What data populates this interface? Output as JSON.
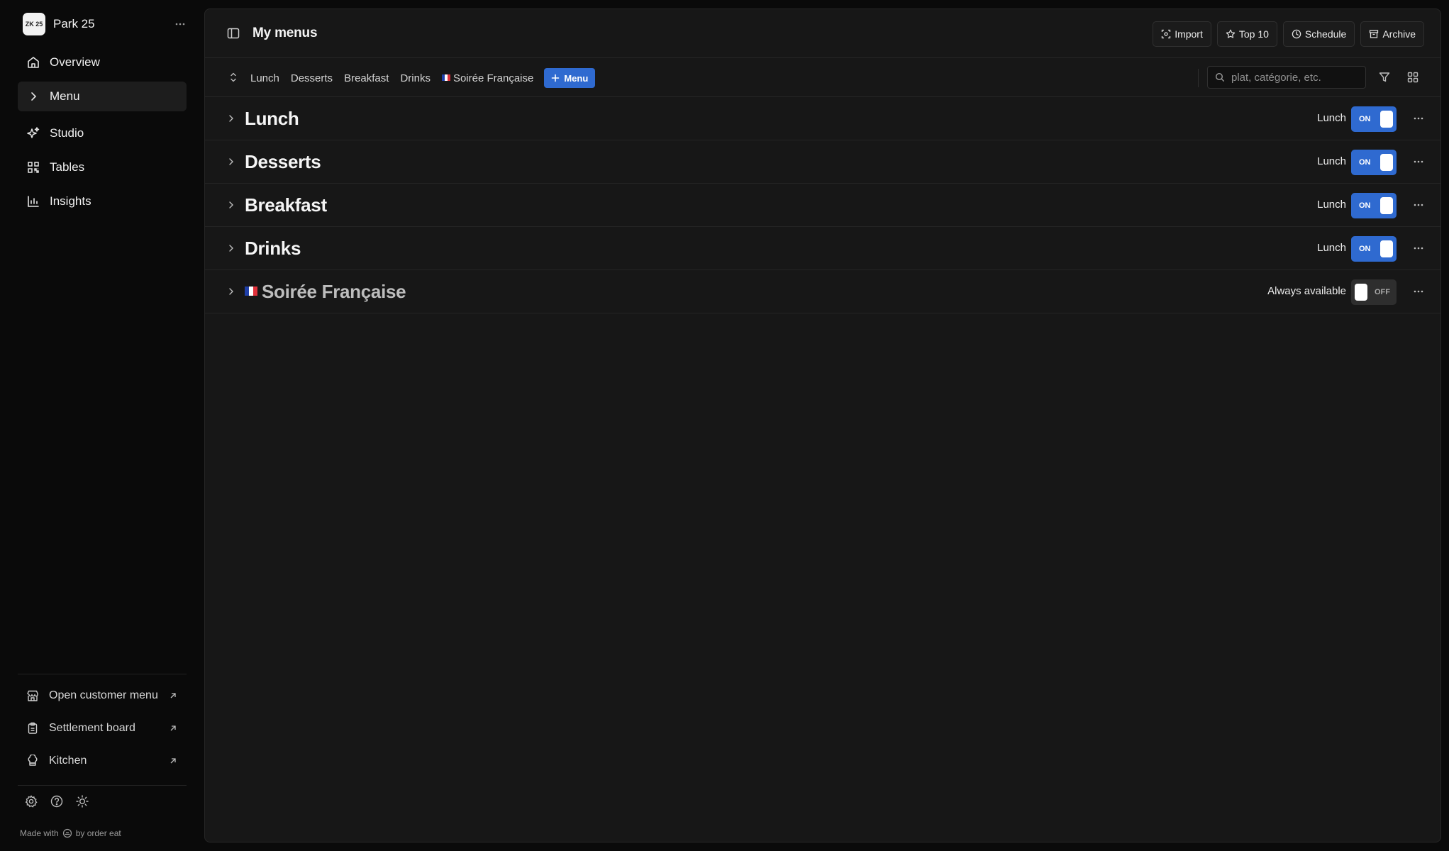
{
  "sidebar": {
    "brand": {
      "logo_text": "ZK 25",
      "name": "Park 25"
    },
    "nav": [
      {
        "label": "Overview",
        "icon": "home-icon"
      },
      {
        "label": "Menu",
        "icon": "chevron-right-icon",
        "active": true
      },
      {
        "label": "Studio",
        "icon": "sparkles-icon"
      },
      {
        "label": "Tables",
        "icon": "qr-code-icon"
      },
      {
        "label": "Insights",
        "icon": "bar-chart-icon"
      }
    ],
    "external": [
      {
        "label": "Open customer menu",
        "icon": "store-icon"
      },
      {
        "label": "Settlement board",
        "icon": "clipboard-icon"
      },
      {
        "label": "Kitchen",
        "icon": "chef-hat-icon"
      }
    ],
    "footer": {
      "made_with": "Made with",
      "by": "by order eat"
    }
  },
  "header": {
    "title": "My menus",
    "actions": [
      {
        "label": "Import",
        "icon": "import-icon"
      },
      {
        "label": "Top 10",
        "icon": "star-icon"
      },
      {
        "label": "Schedule",
        "icon": "clock-icon"
      },
      {
        "label": "Archive",
        "icon": "archive-icon"
      }
    ]
  },
  "toolbar": {
    "tabs": [
      "Lunch",
      "Desserts",
      "Breakfast",
      "Drinks",
      "Soirée Française"
    ],
    "add_button": "Menu",
    "search_placeholder": "plat, catégorie, etc."
  },
  "menus": [
    {
      "name": "Lunch",
      "availability": "Lunch",
      "enabled": true,
      "toggle_label": "ON"
    },
    {
      "name": "Desserts",
      "availability": "Lunch",
      "enabled": true,
      "toggle_label": "ON"
    },
    {
      "name": "Breakfast",
      "availability": "Lunch",
      "enabled": true,
      "toggle_label": "ON"
    },
    {
      "name": "Drinks",
      "availability": "Lunch",
      "enabled": true,
      "toggle_label": "ON"
    },
    {
      "name": "Soirée Française",
      "availability": "Always available",
      "enabled": false,
      "toggle_label": "OFF"
    }
  ],
  "colors": {
    "accent": "#2f6ad0",
    "background": "#0a0a0a",
    "panel": "#171717",
    "flag_blue": "#1f3fa8",
    "flag_white": "#ffffff",
    "flag_red": "#e0313b"
  }
}
